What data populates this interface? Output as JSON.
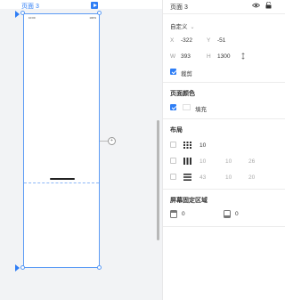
{
  "canvas": {
    "frame_title": "页面 3",
    "status_time": "10:00",
    "status_right": "100%"
  },
  "panel": {
    "title": "页面 3",
    "preset": "自定义",
    "x_label": "X",
    "x_value": "-322",
    "y_label": "Y",
    "y_value": "-51",
    "w_label": "W",
    "w_value": "393",
    "h_label": "H",
    "h_value": "1300",
    "clip_label": "裁剪",
    "page_color_title": "页面颜色",
    "fill_label": "填充",
    "layout_title": "布局",
    "grid_value": "10",
    "columns": [
      "10",
      "10",
      "26"
    ],
    "rows": [
      "43",
      "10",
      "20"
    ],
    "fixed_title": "屏幕固定区域",
    "fixed_top": "0",
    "fixed_bottom": "0"
  },
  "colors": {
    "accent": "#2f7ef5",
    "canvas_bg": "#f2f3f5"
  }
}
